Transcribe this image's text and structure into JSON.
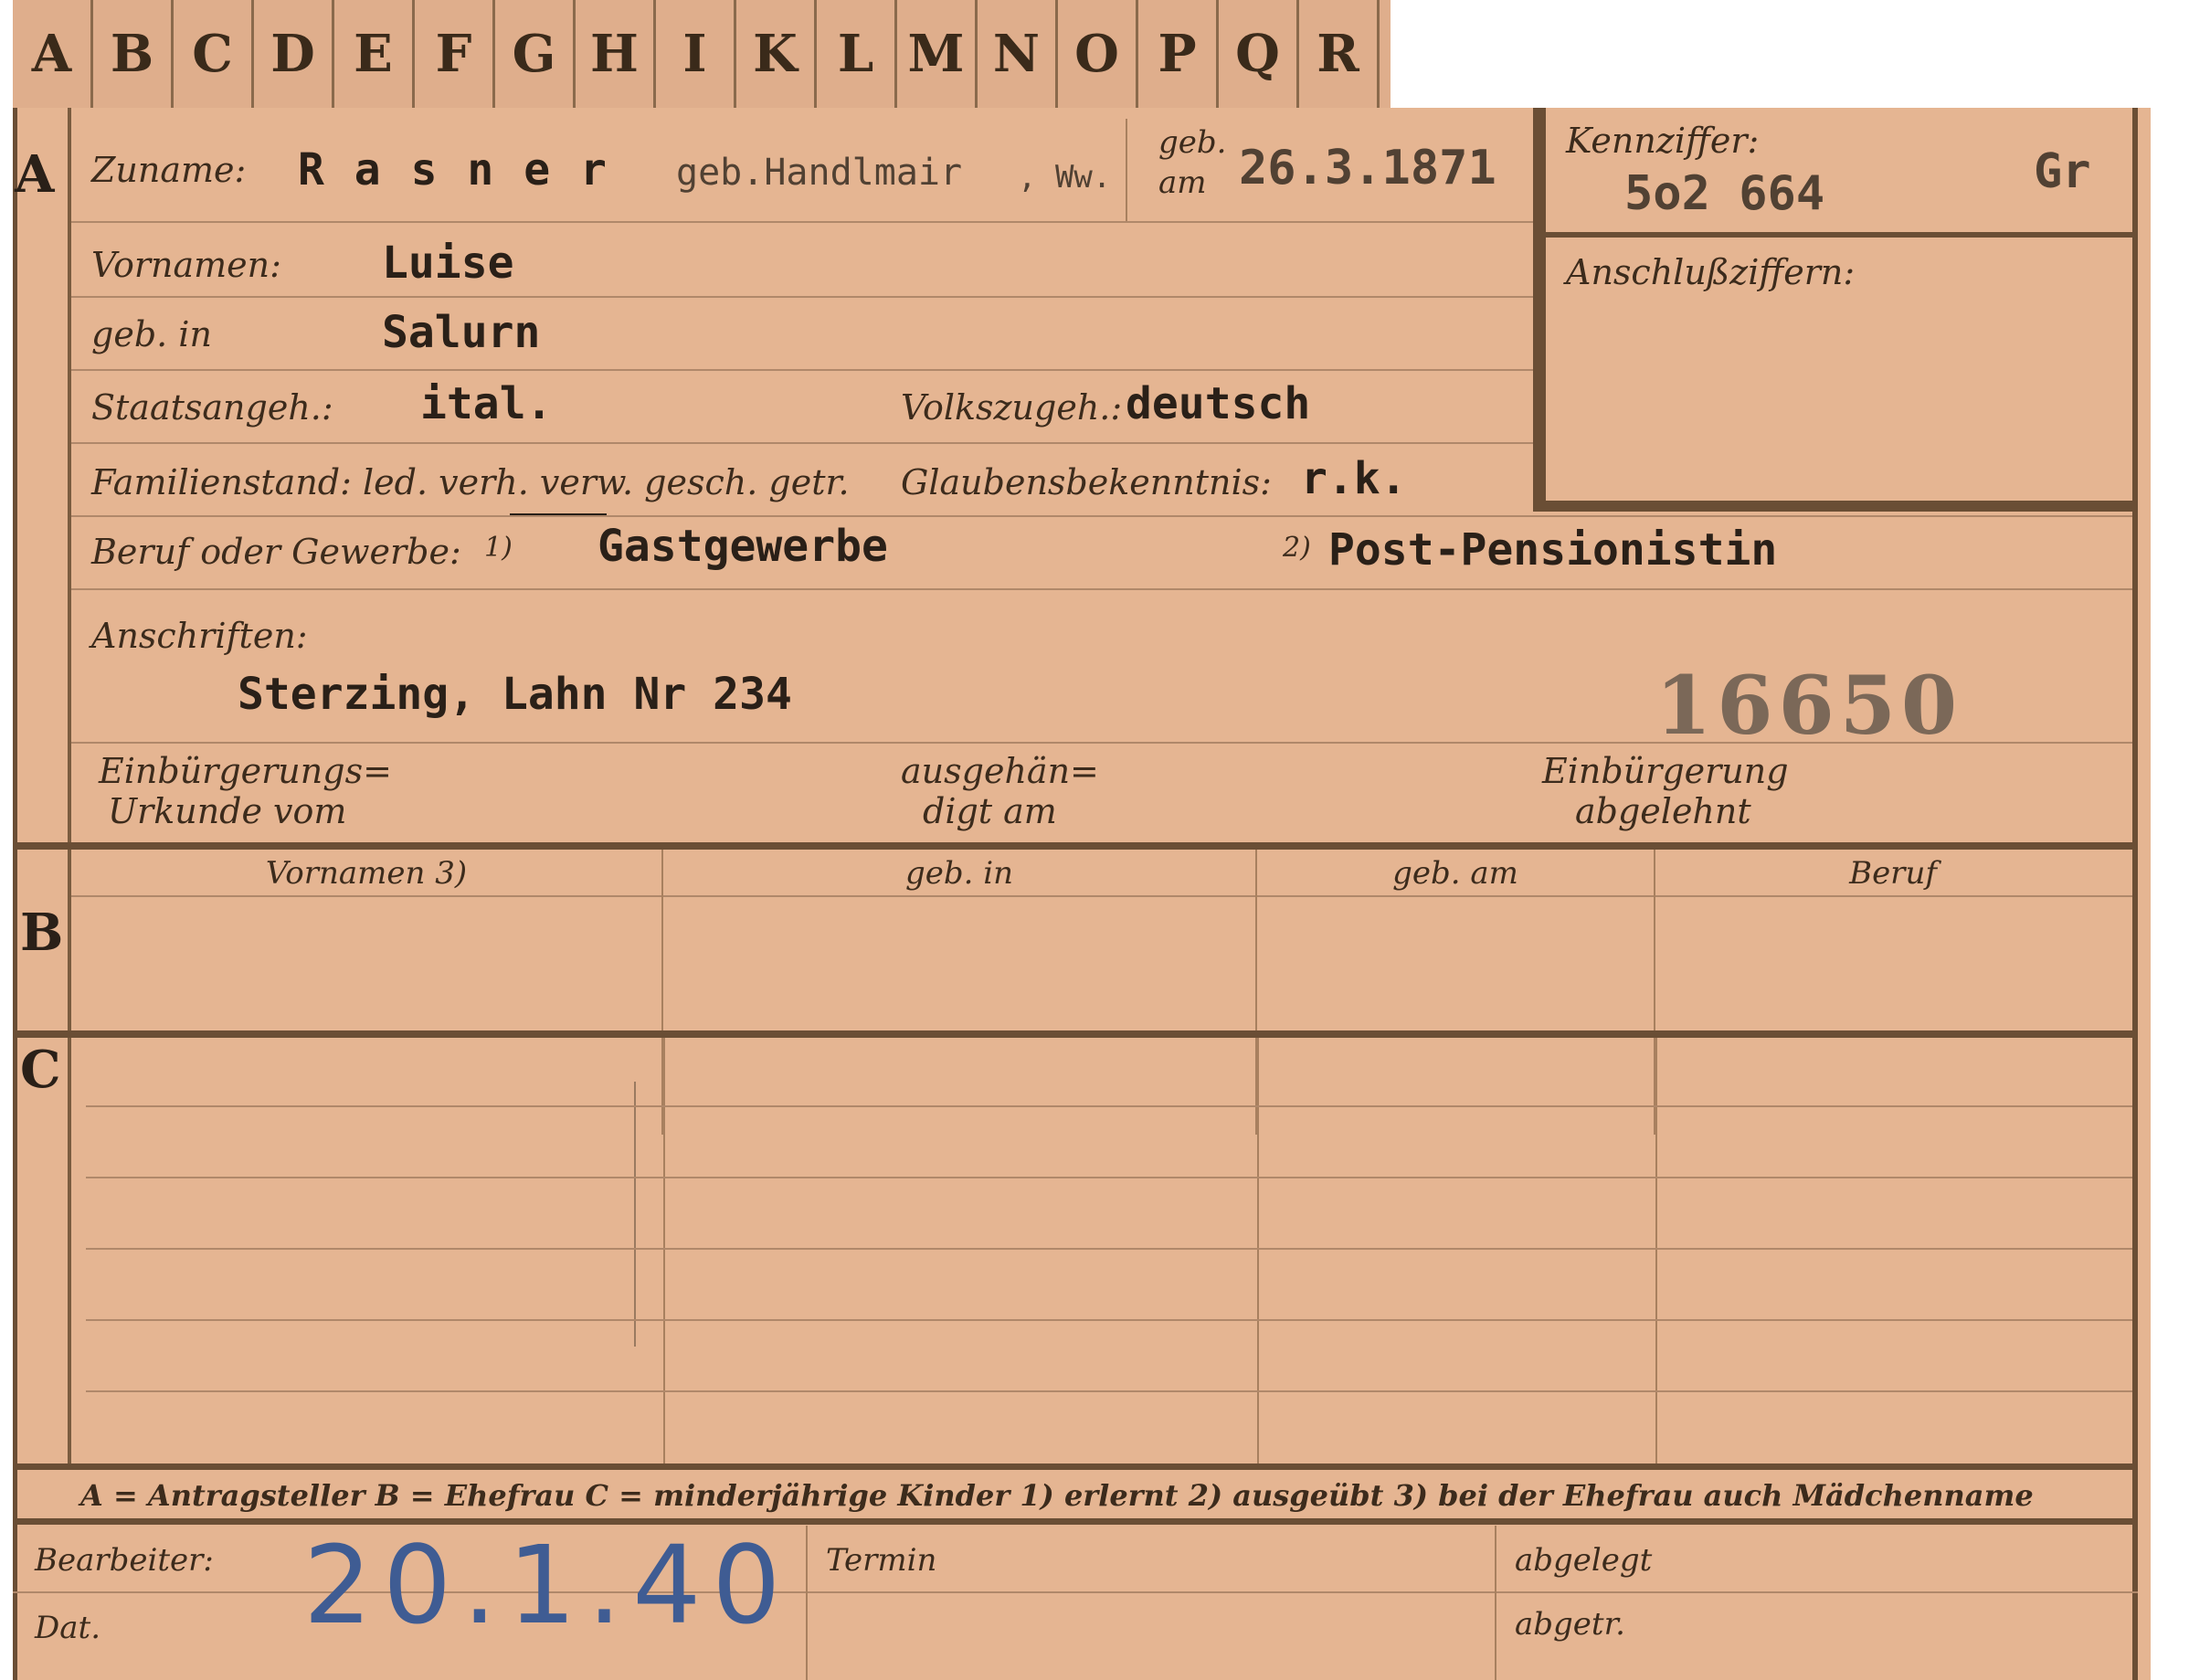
{
  "tabs": [
    "A",
    "B",
    "C",
    "D",
    "E",
    "F",
    "G",
    "H",
    "I",
    "K",
    "L",
    "M",
    "N",
    "O",
    "P",
    "Q",
    "R"
  ],
  "sections": {
    "a": "A",
    "b": "B",
    "c": "C"
  },
  "personal": {
    "surname_label": "Zuname:",
    "surname": "R a s n e r",
    "maiden": "geb.Handlmair",
    "maiden_suffix": ", Ww.",
    "born_on_label_1": "geb.",
    "born_on_label_2": "am",
    "birth_date": "26.3.1871",
    "firstnames_label": "Vornamen:",
    "firstnames": "Luise",
    "birthplace_label": "geb. in",
    "birthplace": "Salurn",
    "citizenship_label": "Staatsangeh.:",
    "citizenship": "ital.",
    "ethnicity_label": "Volkszugeh.:",
    "ethnicity": "deutsch",
    "family_status_label": "Familienstand: led. verh. verw. gesch. getr.",
    "religion_label": "Glaubensbekenntnis:",
    "religion": "r.k.",
    "profession_label": "Beruf oder Gewerbe:",
    "note1": "1)",
    "profession_learned": "Gastgewerbe",
    "note2": "2)",
    "profession_practiced": "Post-Pensionistin",
    "address_label": "Anschriften:",
    "address": "Sterzing, Lahn Nr 234",
    "stamp_number": "16650",
    "naturalization_label_1": "Einbürgerungs=",
    "naturalization_label_2": "Urkunde vom",
    "handed_label_1": "ausgehän=",
    "handed_label_2": "digt am",
    "rejected_label_1": "Einbürgerung",
    "rejected_label_2": "abgelehnt"
  },
  "ident": {
    "label": "Kennziffer:",
    "number": "5o2 664",
    "code": "Gr",
    "linked_label": "Anschlußziffern:"
  },
  "spouse_table": {
    "headers": [
      "Vornamen 3)",
      "geb. in",
      "geb. am",
      "Beruf"
    ]
  },
  "legend": "A = Antragsteller   B = Ehefrau   C = minderjährige Kinder   1) erlernt   2) ausgeübt   3) bei der Ehefrau auch Mädchenname",
  "footer": {
    "clerk_label": "Bearbeiter:",
    "date_label": "Dat.",
    "date_handwritten": "20.1.40",
    "deadline_label": "Termin",
    "filed_label": "abgelegt",
    "other_label": "abgetr."
  }
}
